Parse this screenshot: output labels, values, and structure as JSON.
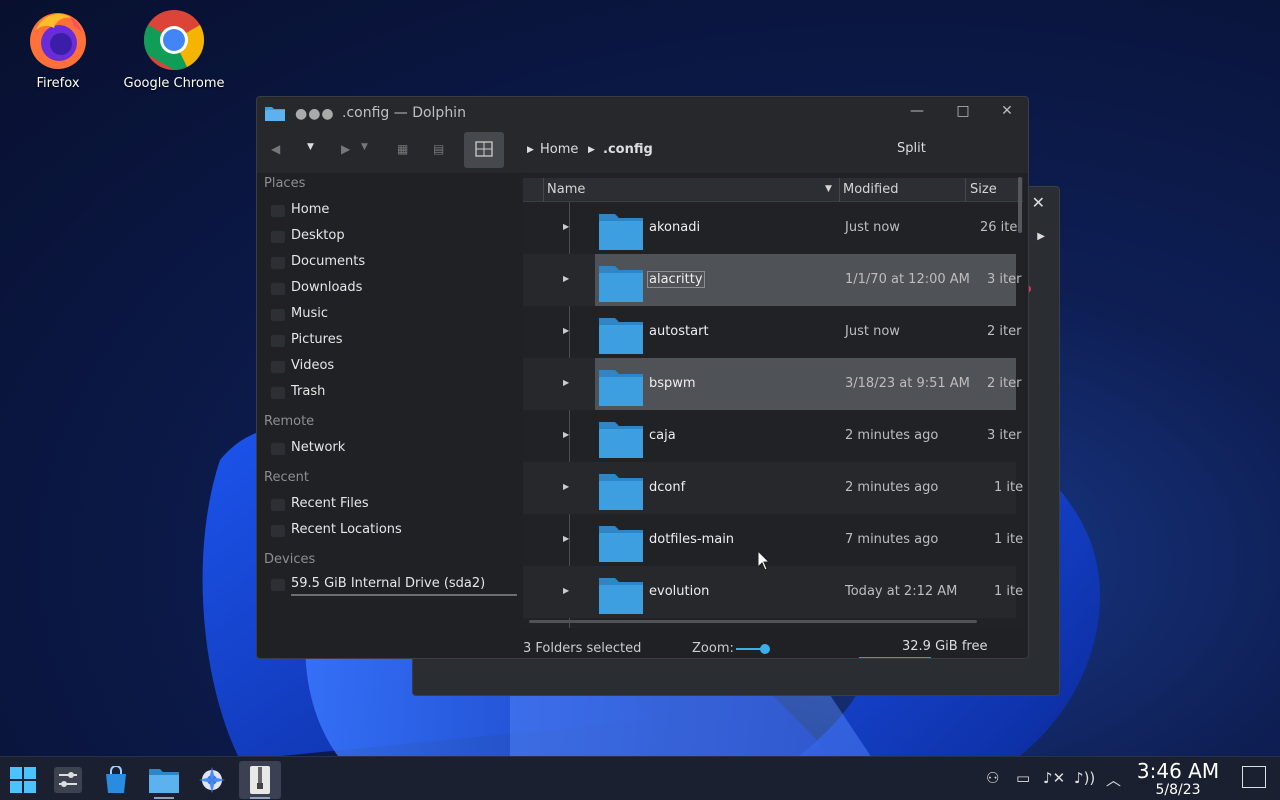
{
  "desktop": {
    "icons": [
      {
        "label": "Firefox",
        "icon": "firefox-icon"
      },
      {
        "label": "Google Chrome",
        "icon": "chrome-icon"
      }
    ]
  },
  "window": {
    "title": ".config — Dolphin",
    "dots": "●●●",
    "controls": {
      "minimize": "—",
      "maximize": "□",
      "close": "✕"
    },
    "breadcrumb": {
      "home": "Home",
      "current": ".config"
    },
    "split_label": "Split"
  },
  "sidebar": {
    "sections": [
      {
        "title": "Places",
        "items": [
          "Home",
          "Desktop",
          "Documents",
          "Downloads",
          "Music",
          "Pictures",
          "Videos",
          "Trash"
        ]
      },
      {
        "title": "Remote",
        "items": [
          "Network"
        ]
      },
      {
        "title": "Recent",
        "items": [
          "Recent Files",
          "Recent Locations"
        ]
      },
      {
        "title": "Devices",
        "items": [
          "59.5 GiB Internal Drive (sda2)"
        ]
      }
    ]
  },
  "file_list": {
    "columns": [
      "Name",
      "Modified",
      "Size"
    ],
    "rows": [
      {
        "name": "akonadi",
        "modified": "Just now",
        "size": "26 ite",
        "selected": false
      },
      {
        "name": "alacritty",
        "modified": "1/1/70 at 12:00 AM",
        "size": "3 iter",
        "selected": true
      },
      {
        "name": "autostart",
        "modified": "Just now",
        "size": "2 iter",
        "selected": false
      },
      {
        "name": "bspwm",
        "modified": "3/18/23 at 9:51 AM",
        "size": "2 iter",
        "selected": true
      },
      {
        "name": "caja",
        "modified": "2 minutes ago",
        "size": "3 iter",
        "selected": false
      },
      {
        "name": "dconf",
        "modified": "2 minutes ago",
        "size": "1 ite",
        "selected": false
      },
      {
        "name": "dotfiles-main",
        "modified": "7 minutes ago",
        "size": "1 ite",
        "selected": false
      },
      {
        "name": "evolution",
        "modified": "Today at 2:12 AM",
        "size": "1 ite",
        "selected": false
      }
    ]
  },
  "status": {
    "selection": "3 Folders selected",
    "zoom_label": "Zoom:",
    "free_space": "32.9 GiB free"
  },
  "taskbar": {
    "clock_time": "3:46 AM",
    "clock_date": "5/8/23"
  },
  "colors": {
    "accent": "#3daee9",
    "folder": "#3d9ee0",
    "selection": "#4f5257"
  }
}
